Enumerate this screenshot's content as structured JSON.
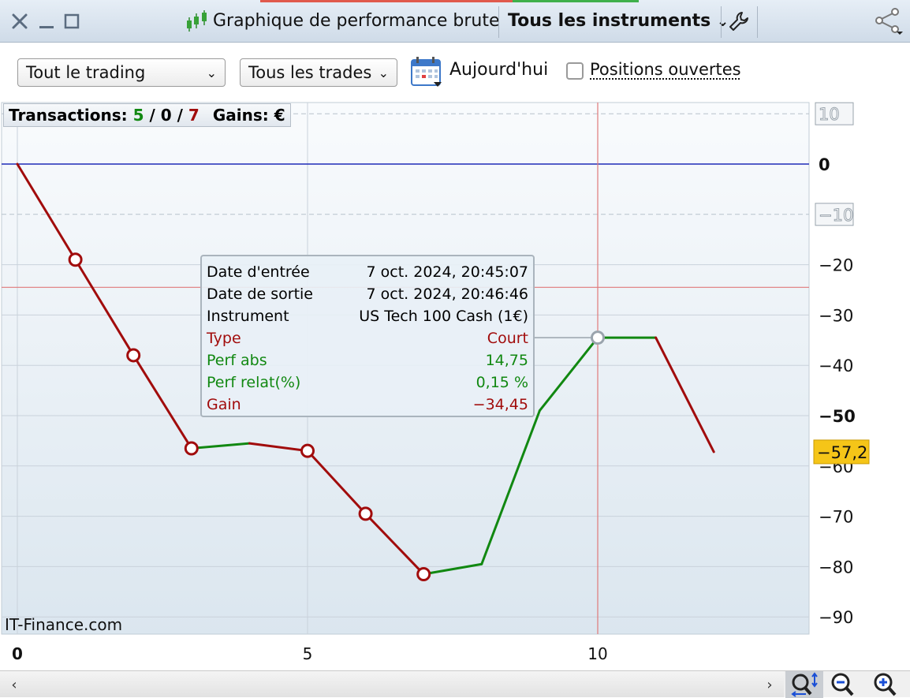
{
  "window": {
    "title": "Graphique de performance brute",
    "instrument_selector": "Tous les instruments"
  },
  "toolbar": {
    "trading_select": {
      "value": "Tout le trading"
    },
    "trades_select": {
      "value": "Tous les trades"
    },
    "today_label": "Aujourd'hui",
    "open_positions": {
      "label": "Positions ouvertes",
      "checked": false
    }
  },
  "stats": {
    "prefix": "Transactions:",
    "wins": "5",
    "sep1": "/",
    "neutral": "0",
    "sep2": "/",
    "losses": "7",
    "gains_label": "Gains:",
    "currency": "€"
  },
  "tooltip": {
    "rows": [
      {
        "label": "Date d'entrée",
        "value": "7 oct. 2024, 20:45:07",
        "color": "#000000"
      },
      {
        "label": "Date de sortie",
        "value": "7 oct. 2024, 20:46:46",
        "color": "#000000"
      },
      {
        "label": "Instrument",
        "value": "US Tech 100 Cash (1€)",
        "color": "#000000"
      },
      {
        "label": "Type",
        "value": "Court",
        "color": "#a10c0c"
      },
      {
        "label": "Perf abs",
        "value": "14,75",
        "color": "#118811"
      },
      {
        "label": "Perf relat(%)",
        "value": "0,15 %",
        "color": "#118811"
      },
      {
        "label": "Gain",
        "value": "−34,45",
        "color": "#a10c0c"
      }
    ]
  },
  "watermark": "IT-Finance.com",
  "colors": {
    "win": "#118811",
    "loss": "#a10c0c",
    "zero_line": "#1f2bb8",
    "crosshair": "#e07a7a",
    "last_value_badge": "#f5c518"
  },
  "chart_data": {
    "type": "line",
    "x": [
      0,
      1,
      2,
      3,
      4,
      5,
      6,
      7,
      8,
      9,
      10,
      11,
      12
    ],
    "y": [
      0,
      -19,
      -38,
      -56.5,
      -55.5,
      -57,
      -69.5,
      -81.5,
      -79.5,
      -49,
      -34.5,
      -34.5,
      -57.2
    ],
    "segment_colors": [
      "loss",
      "loss",
      "loss",
      "win",
      "loss",
      "loss",
      "loss",
      "win",
      "win",
      "win",
      "win",
      "loss"
    ],
    "markers_at": [
      1,
      2,
      3,
      5,
      6,
      7
    ],
    "highlighted_marker": 10,
    "x_ticks": [
      "0",
      "5",
      "10"
    ],
    "x_tick_values": [
      0,
      5,
      10
    ],
    "y_ticks": [
      "10",
      "0",
      "−10",
      "−20",
      "−30",
      "−40",
      "−50",
      "−60",
      "−70",
      "−80",
      "−90"
    ],
    "y_tick_values": [
      10,
      0,
      -10,
      -20,
      -30,
      -40,
      -50,
      -60,
      -70,
      -80,
      -90
    ],
    "xlim": [
      0,
      13.8
    ],
    "ylim": [
      -93,
      12
    ],
    "crosshair": {
      "x": 10,
      "y": -24.5
    },
    "last_value_label": "−57,2",
    "grid": true
  }
}
